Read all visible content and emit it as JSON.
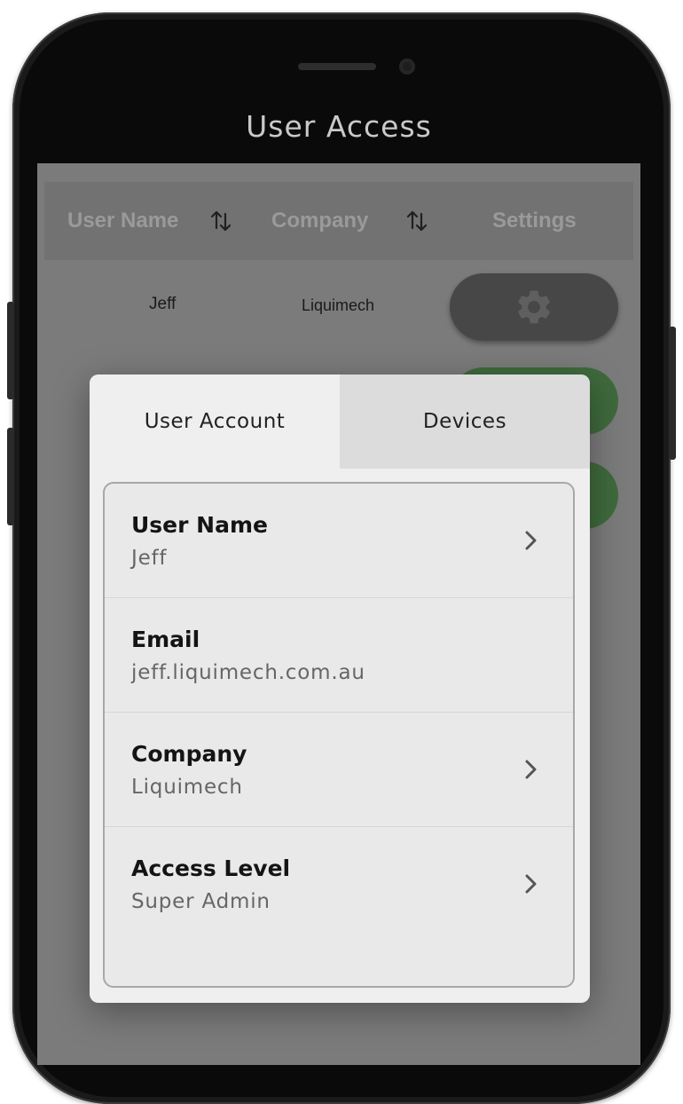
{
  "header": {
    "title": "User Access"
  },
  "table": {
    "columns": [
      {
        "label": "User Name",
        "sortable": true
      },
      {
        "label": "Company",
        "sortable": true
      },
      {
        "label": "Settings",
        "sortable": false
      }
    ],
    "rows": [
      {
        "user": "Jeff",
        "company": "Liquimech"
      }
    ]
  },
  "modal": {
    "tabs": [
      {
        "label": "User Account",
        "active": true
      },
      {
        "label": "Devices",
        "active": false
      }
    ],
    "fields": [
      {
        "label": "User Name",
        "value": "Jeff",
        "has_chevron": true
      },
      {
        "label": "Email",
        "value": "jeff.liquimech.com.au",
        "has_chevron": false
      },
      {
        "label": "Company",
        "value": "Liquimech",
        "has_chevron": true
      },
      {
        "label": "Access Level",
        "value": "Super Admin",
        "has_chevron": true
      }
    ]
  },
  "icons": {
    "sort": "sort-arrows-icon",
    "settings": "gear-icon",
    "chevron": "chevron-right-icon"
  },
  "colors": {
    "overlay": "#7b7b7b",
    "button_green": "#3f6a3c",
    "button_dark": "#474747",
    "modal_bg": "#efefef",
    "tab_inactive": "#dcdcdc"
  }
}
